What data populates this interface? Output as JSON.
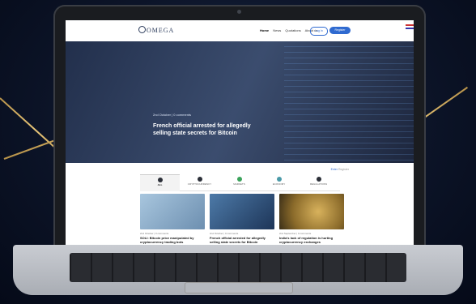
{
  "colors": {
    "accent": "#2f6ad0",
    "gold": "#d8b46a"
  },
  "site": {
    "logo_text": "OMEGA",
    "nav": {
      "home": "Home",
      "news": "News",
      "quotations": "Quotations",
      "about": "About us"
    },
    "login_label": "Log In",
    "register_label": "Register"
  },
  "hero": {
    "meta": "2nd October | 0 comments",
    "title": "French official arrested for allegedly selling state secrets for Bitcoin"
  },
  "auth_links": {
    "enter": "Enter",
    "register": "Register"
  },
  "tabs": [
    {
      "label": "ALL",
      "color": "#2b2f38"
    },
    {
      "label": "CRYPTOCURRENCY",
      "color": "#2b2f38"
    },
    {
      "label": "MARKETS",
      "color": "#3aa35b"
    },
    {
      "label": "ECONOMY",
      "color": "#4a9aa8"
    },
    {
      "label": "REGULATIONS",
      "color": "#2b2f38"
    }
  ],
  "cards": [
    {
      "meta": "2nd October | 0 comments",
      "title": "SOLI: Bitcoin price manipulated by cryptocurrency trading bots",
      "img_color": "#7d9fbf"
    },
    {
      "meta": "2nd October | 0 comments",
      "title": "French official arrested for allegedly selling state secrets for Bitcoin",
      "img_color": "#2a4d74"
    },
    {
      "meta": "2nd September | 0 comments",
      "title": "India's lack of regulation is hurting cryptocurrency exchanges",
      "img_color": "#b5913f"
    }
  ]
}
